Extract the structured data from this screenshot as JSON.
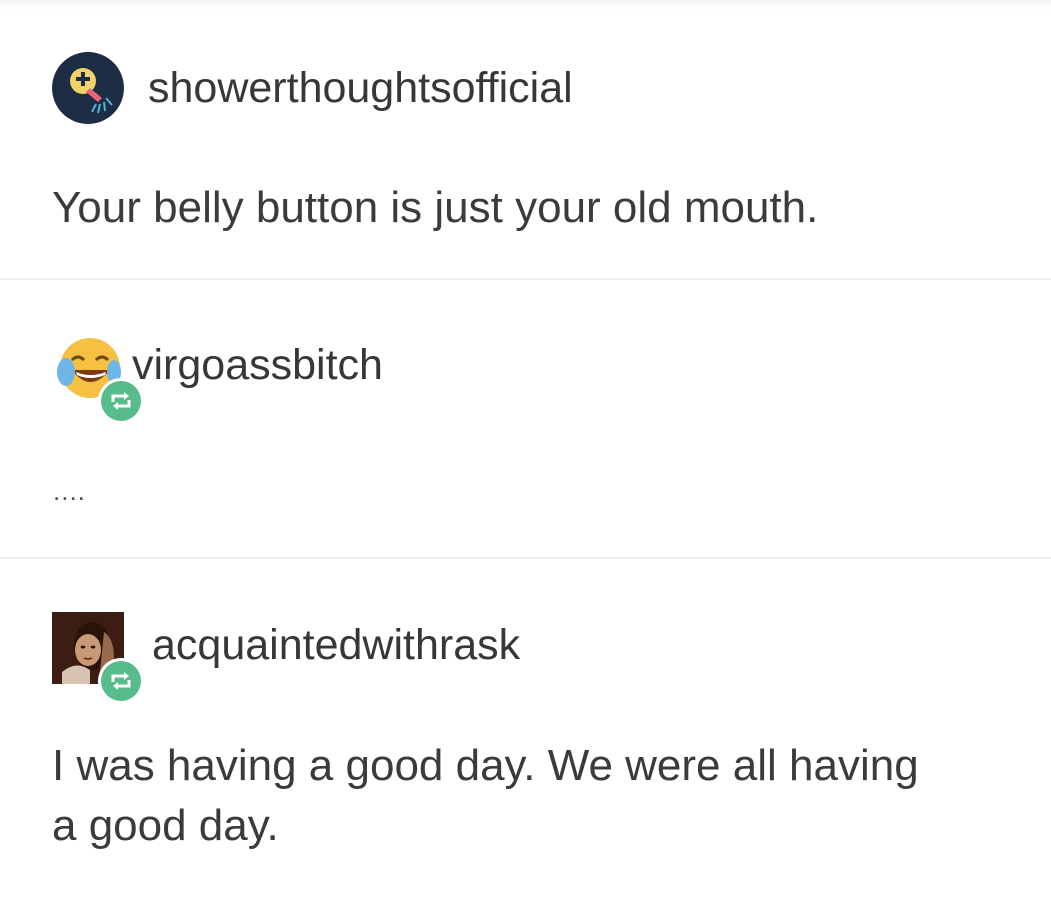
{
  "posts": [
    {
      "username": "showerthoughtsofficial",
      "text": "Your belly button is just your old mouth.",
      "avatar_icon": "shower-head-icon",
      "reblog": false
    },
    {
      "username": "virgoassbitch",
      "text": "....",
      "avatar_icon": "laughing-crying-emoji-icon",
      "reblog": true
    },
    {
      "username": "acquaintedwithrask",
      "text": "I was having a good day. We were all having a good day.",
      "avatar_icon": "painting-portrait-icon",
      "reblog": true
    }
  ],
  "colors": {
    "reblog_green": "#56bc8a",
    "text": "#36373a",
    "divider": "#eeeeee",
    "avatar_navy": "#1d2d44"
  }
}
